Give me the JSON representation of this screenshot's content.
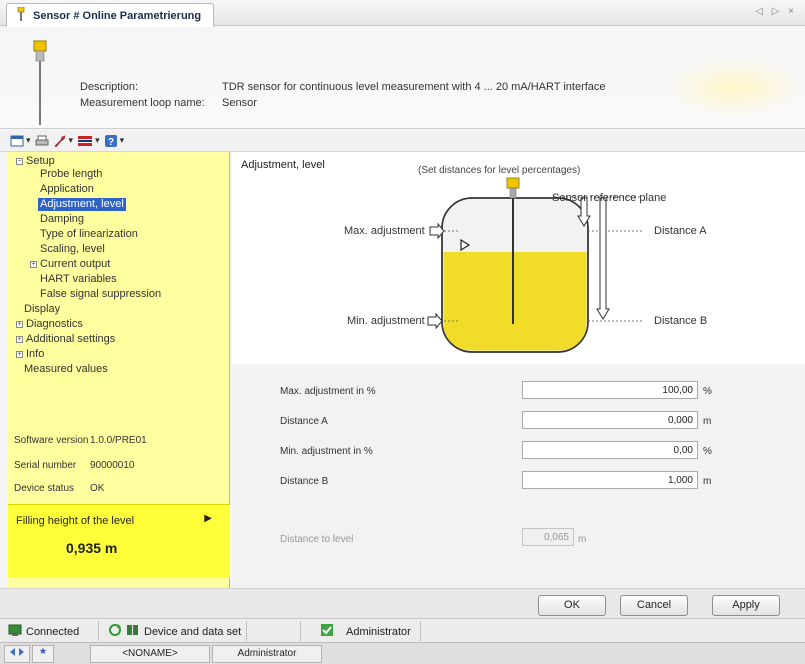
{
  "tab": {
    "title": "Sensor # Online Parametrierung",
    "controls": "◁ ▷ ×"
  },
  "header": {
    "description_label": "Description:",
    "description_value": "TDR sensor for continuous level measurement with 4 ... 20 mA/HART interface",
    "loop_label": "Measurement loop name:",
    "loop_value": "Sensor"
  },
  "toolbar": {
    "icons": [
      "window-icon",
      "printer-icon",
      "wrench-icon",
      "flag-icon",
      "help-icon"
    ]
  },
  "tree": {
    "setup": "Setup",
    "probe_length": "Probe length",
    "application": "Application",
    "adjustment_level": "Adjustment, level",
    "damping": "Damping",
    "linearization": "Type of linearization",
    "scaling": "Scaling, level",
    "current_output": "Current output",
    "hart": "HART variables",
    "false_signal": "False signal suppression",
    "display": "Display",
    "diagnostics": "Diagnostics",
    "additional": "Additional settings",
    "info": "Info",
    "measured": "Measured values"
  },
  "device": {
    "software_label": "Software version",
    "software_value": "1.0.0/PRE01",
    "serial_label": "Serial number",
    "serial_value": "90000010",
    "status_label": "Device status",
    "status_value": "OK"
  },
  "filling": {
    "label": "Filling height of the level",
    "value": "0,935 m"
  },
  "adjustment": {
    "title": "Adjustment, level",
    "hint": "(Set distances for level percentages)",
    "ref_plane": "Sensor reference plane",
    "max_adj": "Max. adjustment",
    "min_adj": "Min. adjustment",
    "dist_a": "Distance A",
    "dist_b": "Distance B"
  },
  "form": {
    "max_label": "Max. adjustment in %",
    "max_value": "100,00",
    "max_unit": "%",
    "dist_a_label": "Distance A",
    "dist_a_value": "0,000",
    "dist_a_unit": "m",
    "min_label": "Min. adjustment in %",
    "min_value": "0,00",
    "min_unit": "%",
    "dist_b_label": "Distance B",
    "dist_b_value": "1,000",
    "dist_b_unit": "m",
    "level_label": "Distance to level",
    "level_value": "0,065",
    "level_unit": "m"
  },
  "buttons": {
    "ok": "OK",
    "cancel": "Cancel",
    "apply": "Apply"
  },
  "status": {
    "connected": "Connected",
    "device_data": "Device and data set",
    "user": "Administrator"
  },
  "bottom": {
    "noname": "<NONAME>",
    "user": "Administrator"
  },
  "colors": {
    "tree_bg": "#ffffa0",
    "filling_bg": "#ffff3a",
    "selection": "#2d63c8",
    "liquid": "#f2dc2a"
  }
}
